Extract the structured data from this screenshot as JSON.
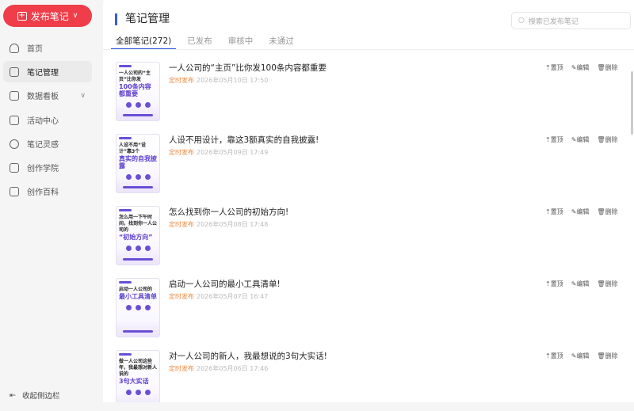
{
  "sidebar": {
    "publish_label": "发布笔记",
    "items": [
      {
        "label": "首页",
        "icon": "home-icon"
      },
      {
        "label": "笔记管理",
        "icon": "note-icon",
        "active": true
      },
      {
        "label": "数据看板",
        "icon": "chart-icon",
        "expandable": true
      },
      {
        "label": "活动中心",
        "icon": "flag-icon"
      },
      {
        "label": "笔记灵感",
        "icon": "lightbulb-icon"
      },
      {
        "label": "创作学院",
        "icon": "graduation-cap-icon"
      },
      {
        "label": "创作百科",
        "icon": "book-icon"
      }
    ],
    "collapse_label": "收起侧边栏"
  },
  "header": {
    "title": "笔记管理",
    "search_placeholder": "搜索已发布笔记"
  },
  "tabs": [
    {
      "label": "全部笔记(272)",
      "active": true
    },
    {
      "label": "已发布"
    },
    {
      "label": "审核中"
    },
    {
      "label": "未通过"
    }
  ],
  "actions": {
    "pin": "置顶",
    "edit": "编辑",
    "delete": "删除"
  },
  "accent": "#3b5bdb",
  "brand": "#ef3e4a",
  "status_color": "#f08a3c",
  "notes": [
    {
      "title": "一人公司的“主页”比你发100条内容都重要",
      "status": "定时发布",
      "time": "2026年05月10日 17:50",
      "thumb_a": "一人公司的“主页”比你发",
      "thumb_b": "100条内容都重要"
    },
    {
      "title": "人设不用设计，靠这3额真实的自我披露!",
      "status": "定时发布",
      "time": "2026年05月09日 17:49",
      "thumb_a": "人设不用“设计”靠3个",
      "thumb_b": "真实的自我披露"
    },
    {
      "title": "怎么找到你一人公司的初始方向!",
      "status": "定时发布",
      "time": "2026年05月08日 17:48",
      "thumb_a": "怎么用一下午时间，找到你一人公司的",
      "thumb_b": "“初始方向”"
    },
    {
      "title": "启动一人公司的最小工具清单!",
      "status": "定时发布",
      "time": "2026年05月07日 16:47",
      "thumb_a": "启动一人公司的",
      "thumb_b": "最小工具清单"
    },
    {
      "title": "对一人公司的新人，我最想说的3句大实话!",
      "status": "定时发布",
      "time": "2026年05月06日 17:46",
      "thumb_a": "做一人公司这些年，我最想对新人说的",
      "thumb_b": "3句大实话"
    }
  ]
}
